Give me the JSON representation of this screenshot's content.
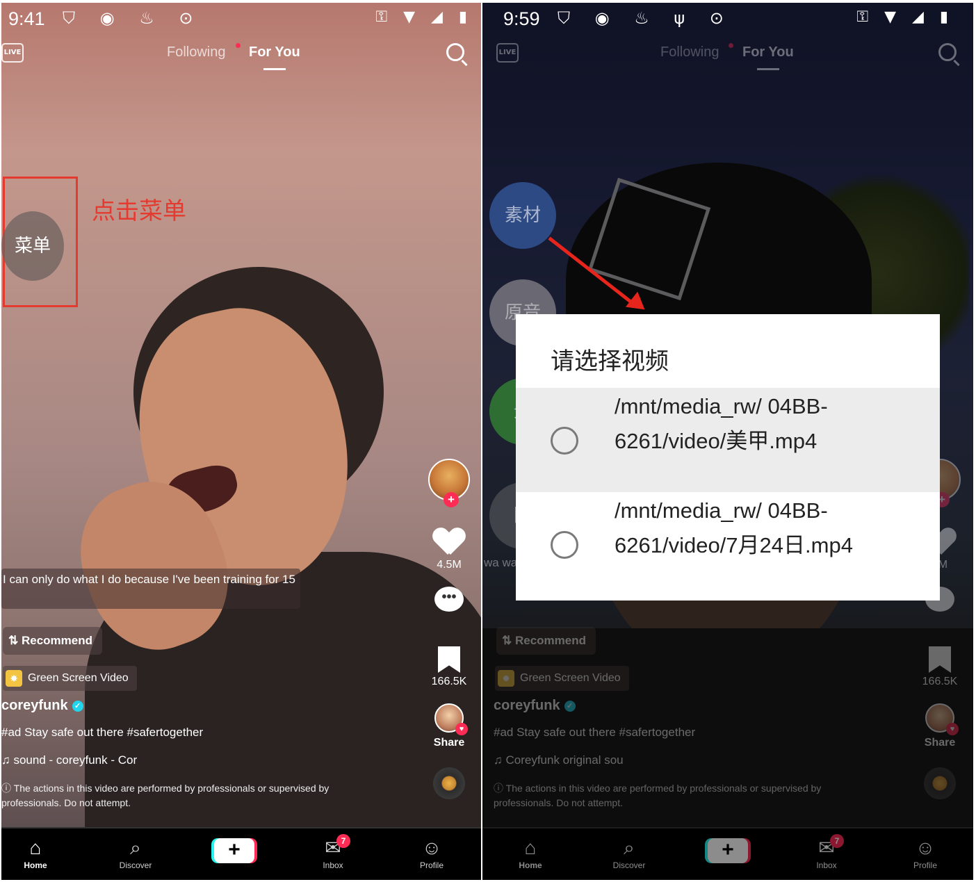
{
  "left": {
    "status": {
      "time": "9:41",
      "left_icons": "⛉ ◉ ♨ ⊙",
      "right_icons": "⚿ ▼ ◢ ▮"
    },
    "nav": {
      "live": "LIVE",
      "following": "Following",
      "for_you": "For You"
    },
    "annotation": {
      "menu_button": "菜单",
      "instruction": "点击菜单"
    },
    "caption": "I can only do what I do because I've been training for 15",
    "recommend": "⇅ Recommend",
    "green_screen": "Green Screen Video",
    "username": "coreyfunk",
    "description": "#ad Stay safe out there #safertogether",
    "sound": "♫  sound - coreyfunk - Cor",
    "warning": "ⓘ The actions in this video are performed by professionals or supervised by professionals. Do not attempt.",
    "actions": {
      "likes": "4.5M",
      "comment_glyph": "•••",
      "bookmarks": "166.5K",
      "share": "Share"
    },
    "tabbar": {
      "home": "Home",
      "discover": "Discover",
      "create": "+",
      "inbox": "Inbox",
      "inbox_badge": "7",
      "profile": "Profile"
    }
  },
  "right": {
    "status": {
      "time": "9:59",
      "left_icons": "⛉ ◉ ♨ ψ ⊙",
      "right_icons": "⚿ ▼ ◢ ▮"
    },
    "nav": {
      "live": "LIVE",
      "following": "Following",
      "for_you": "For You"
    },
    "bubbles": {
      "material": "素材",
      "original": "原音",
      "none": "无",
      "hidden": "隐"
    },
    "dialog": {
      "title": "请选择视频",
      "options": [
        {
          "path": "/mnt/media_rw/ 04BB-6261/video/美甲.mp4"
        },
        {
          "path": "/mnt/media_rw/ 04BB-6261/video/7月24日.mp4"
        }
      ]
    },
    "behind_text": "wa wa mo",
    "recommend": "⇅ Recommend",
    "green_screen": "Green Screen Video",
    "username": "coreyfunk",
    "description": "#ad Stay safe out there #safertogether",
    "sound": "♫  Coreyfunk   original sou",
    "warning": "ⓘ The actions in this video are performed by professionals or supervised by professionals. Do not attempt.",
    "actions": {
      "likes": "5M",
      "bookmarks": "166.5K",
      "share": "Share"
    },
    "tabbar": {
      "home": "Home",
      "discover": "Discover",
      "create": "+",
      "inbox": "Inbox",
      "inbox_badge": "7",
      "profile": "Profile"
    }
  },
  "colors": {
    "annotation_red": "#e53a2f",
    "tiktok_red": "#fe2c55",
    "tiktok_cyan": "#25f4ee"
  }
}
